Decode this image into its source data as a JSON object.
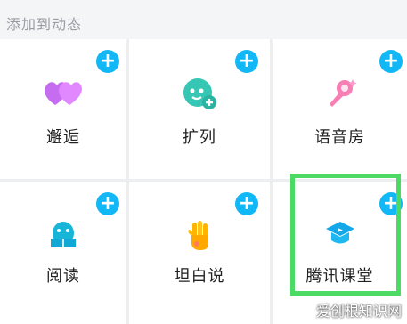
{
  "header": {
    "title": "添加到动态"
  },
  "tiles": [
    {
      "label": "邂逅",
      "icon": "hearts-icon"
    },
    {
      "label": "扩列",
      "icon": "add-friend-face-icon"
    },
    {
      "label": "语音房",
      "icon": "microphone-icon"
    },
    {
      "label": "阅读",
      "icon": "reading-penguin-icon"
    },
    {
      "label": "坦白说",
      "icon": "raised-hand-icon"
    },
    {
      "label": "腾讯课堂",
      "icon": "graduation-play-icon"
    }
  ],
  "plus_symbol": "+",
  "watermark": "爱创根知识网",
  "colors": {
    "accent": "#12b7f5",
    "highlight": "#4cd964",
    "background": "#f4f5f7"
  }
}
